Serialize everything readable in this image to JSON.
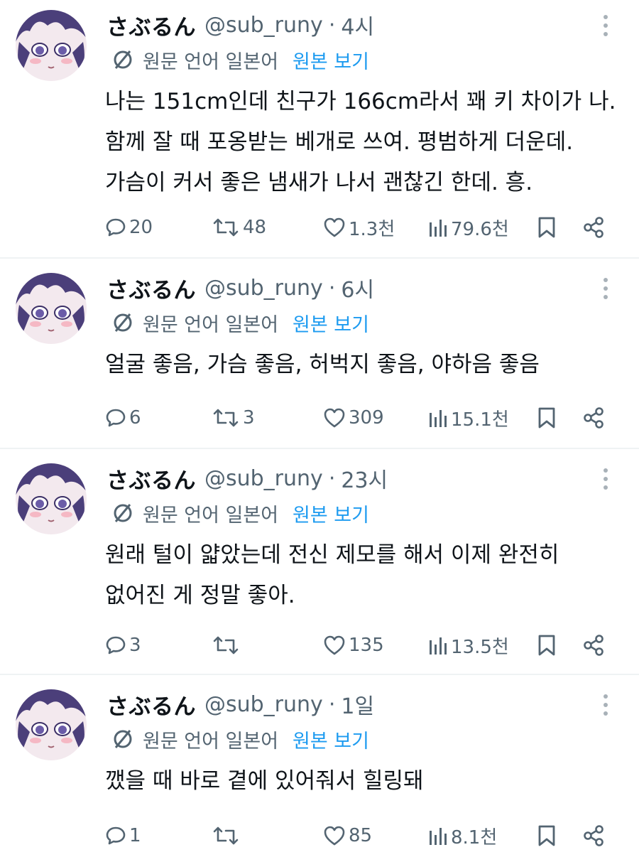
{
  "tweets": [
    {
      "name": "さぶるん",
      "handle": "@sub_runy",
      "time": "4시",
      "translate_label": "원문 언어 일본어",
      "translate_link": "원본 보기",
      "lines": [
        "나는 151cm인데 친구가 166cm라서 꽤 키 차이가 나.",
        "함께 잘 때 포옹받는 베개로 쓰여. 평범하게 더운데.",
        "가슴이 커서 좋은 냄새가 나서 괜찮긴 한데. 흥."
      ],
      "replies": "20",
      "retweets": "48",
      "likes": "1.3천",
      "views": "79.6천"
    },
    {
      "name": "さぶるん",
      "handle": "@sub_runy",
      "time": "6시",
      "translate_label": "원문 언어 일본어",
      "translate_link": "원본 보기",
      "lines": [
        "얼굴 좋음, 가슴 좋음, 허벅지 좋음, 야하음 좋음"
      ],
      "replies": "6",
      "retweets": "3",
      "likes": "309",
      "views": "15.1천"
    },
    {
      "name": "さぶるん",
      "handle": "@sub_runy",
      "time": "23시",
      "translate_label": "원문 언어 일본어",
      "translate_link": "원본 보기",
      "lines": [
        "원래 털이 얇았는데 전신 제모를 해서 이제 완전히",
        "없어진 게 정말 좋아."
      ],
      "replies": "3",
      "retweets": "",
      "likes": "135",
      "views": "13.5천"
    },
    {
      "name": "さぶるん",
      "handle": "@sub_runy",
      "time": "1일",
      "translate_label": "원문 언어 일본어",
      "translate_link": "원본 보기",
      "lines": [
        "깼을 때 바로 곁에 있어줘서 힐링돼"
      ],
      "replies": "1",
      "retweets": "",
      "likes": "85",
      "views": "8.1천"
    }
  ],
  "icons": {
    "reply": "reply-icon",
    "retweet": "retweet-icon",
    "like": "heart-icon",
    "views": "views-icon",
    "bookmark": "bookmark-icon",
    "share": "share-icon",
    "more": "more-icon",
    "translate": "translate-icon"
  },
  "colors": {
    "text": "#0f1419",
    "secondary": "#536471",
    "link": "#1d9bf0",
    "divider": "#eff3f4"
  }
}
